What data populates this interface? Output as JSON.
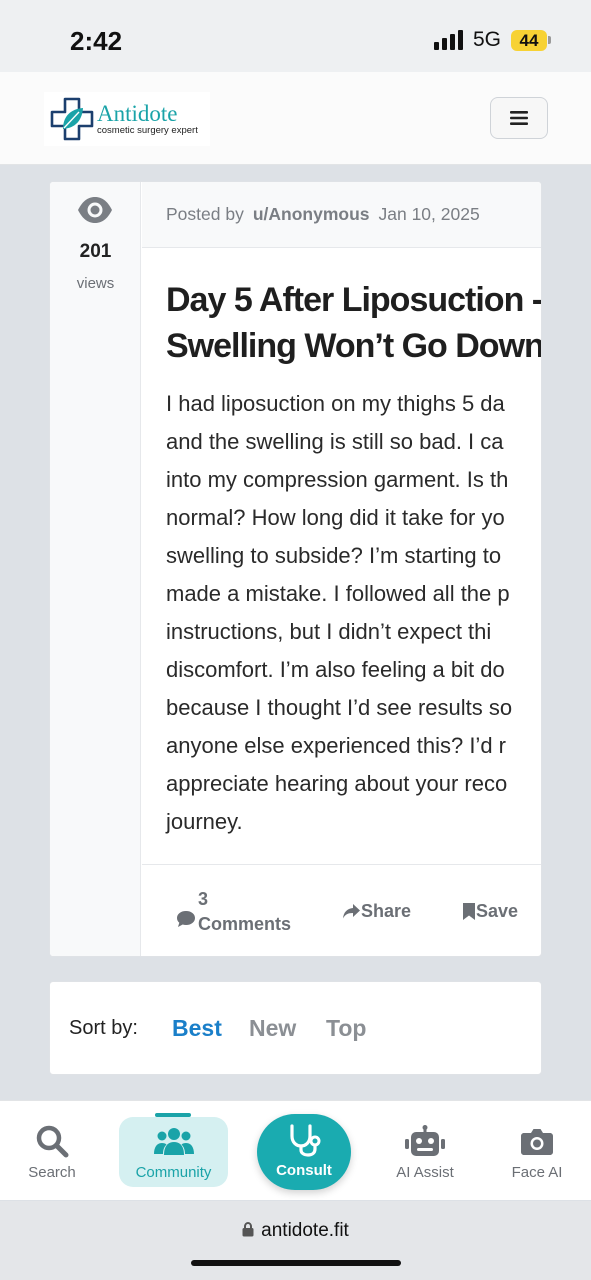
{
  "status_bar": {
    "time": "2:42",
    "network": "5G",
    "battery": "44"
  },
  "header": {
    "brand": "Antidote",
    "tagline": "cosmetic surgery expert",
    "menu_icon": "hamburger-icon"
  },
  "post": {
    "views_count": "201",
    "views_label": "views",
    "posted_by_label": "Posted by",
    "author": "u/Anonymous",
    "date": "Jan 10, 2025",
    "title_lines": [
      "Day 5 After Liposuction -",
      "Swelling Won’t Go Down!"
    ],
    "body_lines": [
      "I had liposuction on my thighs 5 da",
      "and the swelling is still so bad. I ca",
      "into my compression garment. Is th",
      "normal? How long did it take for yo",
      "swelling to subside? I’m starting to",
      "made a mistake. I followed all the p",
      "instructions, but I didn’t expect thi",
      "discomfort. I’m also feeling a bit do",
      "because I thought I’d see results so",
      "anyone else experienced this? I’d r",
      "appreciate hearing about your reco",
      "journey."
    ],
    "actions": {
      "comments_count": "3",
      "comments_label": "Comments",
      "share_label": "Share",
      "save_label": "Save"
    }
  },
  "sort": {
    "label": "Sort by:",
    "options": [
      "Best",
      "New",
      "Top"
    ],
    "selected": "Best"
  },
  "bottom_nav": [
    {
      "label": "Search",
      "icon": "search-icon"
    },
    {
      "label": "Community",
      "icon": "community-icon",
      "active": true
    },
    {
      "label": "Consult",
      "icon": "stethoscope-icon"
    },
    {
      "label": "AI Assist",
      "icon": "robot-icon"
    },
    {
      "label": "Face AI",
      "icon": "camera-icon"
    }
  ],
  "url_bar": {
    "url": "antidote.fit"
  },
  "colors": {
    "accent": "#1aa3a8",
    "sort_active": "#1a7fc9"
  }
}
